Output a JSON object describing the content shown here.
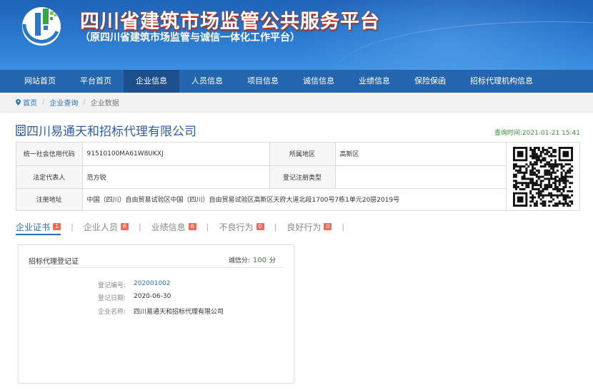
{
  "header": {
    "title": "四川省建筑市场监管公共服务平台",
    "subtitle": "（原四川省建筑市场监管与诚信一体化工作平台）"
  },
  "nav": {
    "items": [
      {
        "label": "网站首页"
      },
      {
        "label": "平台首页"
      },
      {
        "label": "企业信息",
        "active": true
      },
      {
        "label": "人员信息"
      },
      {
        "label": "项目信息"
      },
      {
        "label": "诚信信息"
      },
      {
        "label": "业绩信息"
      },
      {
        "label": "保险保函"
      },
      {
        "label": "招标代理机构信息"
      }
    ]
  },
  "breadcrumb": {
    "home": "首页",
    "level2": "企业查询",
    "current": "企业数据"
  },
  "company": {
    "name": "四川易通天和招标代理有限公司",
    "query_time": "查询时间:2021-01-21 15:41"
  },
  "info": {
    "credit_code_label": "统一社会信用代码",
    "credit_code": "91510100MA61W8UKXJ",
    "region_label": "所属地区",
    "region": "高新区",
    "legal_rep_label": "法定代表人",
    "legal_rep": "范方锐",
    "reg_type_label": "登记注册类型",
    "reg_type": "",
    "address_label": "注册地址",
    "address": "中国（四川）自由贸易试验区中国（四川）自由贸易试验区高新区天府大道北段1700号7栋1单元20层2019号"
  },
  "tabs": [
    {
      "label": "企业证书",
      "count": "1",
      "active": true
    },
    {
      "label": "企业人员",
      "count": "6"
    },
    {
      "label": "业绩信息",
      "count": "6"
    },
    {
      "label": "不良行为",
      "count": "0"
    },
    {
      "label": "良好行为",
      "count": "0"
    }
  ],
  "certificate": {
    "title": "招标代理登记证",
    "score_label": "诚信分:",
    "score": "100",
    "score_unit": "分",
    "fields": [
      {
        "key": "登记编号:",
        "value": "202001002"
      },
      {
        "key": "登记日期:",
        "value": "2020-06-30"
      },
      {
        "key": "企业名称:",
        "value": "四川易通天和招标代理有限公司"
      }
    ]
  },
  "colors": {
    "banner": "#2a7ad0",
    "nav": "#2465b0",
    "nav_active": "#1c4f8c",
    "link": "#2d6ebd",
    "badge": "#f06a5a",
    "score": "#3a8a3a"
  }
}
